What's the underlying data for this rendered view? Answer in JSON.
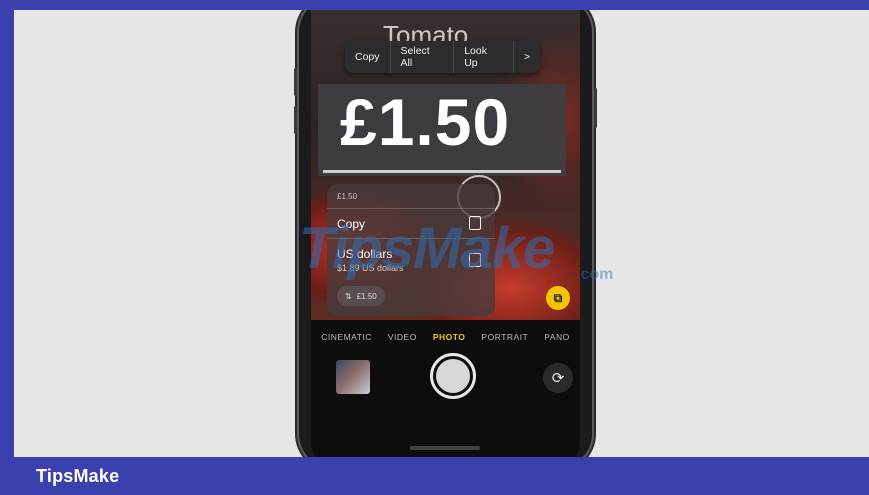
{
  "footer": {
    "brand": "TipsMake"
  },
  "camera": {
    "label_text": "Tomato",
    "context_menu": [
      "Copy",
      "Select All",
      "Look Up",
      ">"
    ],
    "price": "£1.50",
    "popup": {
      "header": "£1.50",
      "copy_label": "Copy",
      "currency_label": "US dollars",
      "currency_value": "$1.89 US dollars",
      "chip_text": "£1.50",
      "chip_icon": "convert-icon"
    },
    "modes": [
      "CINEMATIC",
      "VIDEO",
      "PHOTO",
      "PORTRAIT",
      "PANO"
    ],
    "active_mode": "PHOTO"
  },
  "watermark": {
    "text": "TipsMake",
    "suffix": ".com"
  },
  "colors": {
    "accent_blue": "#3a40ad",
    "camera_yellow": "#f5c400",
    "active_mode": "#f0c31a"
  }
}
